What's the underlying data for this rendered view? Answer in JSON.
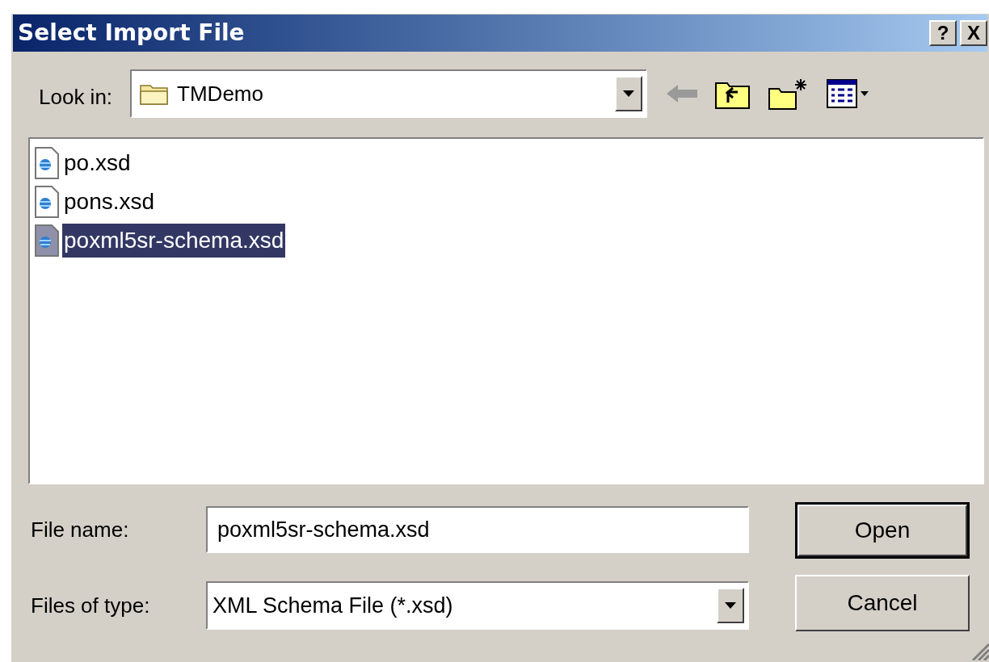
{
  "window": {
    "title": "Select Import File",
    "title_buttons": [
      "?",
      "X"
    ]
  },
  "look_in": {
    "label": "Look in:",
    "value": "TMDemo"
  },
  "files": [
    {
      "name": "po.xsd",
      "selected": false
    },
    {
      "name": "pons.xsd",
      "selected": false
    },
    {
      "name": "poxml5sr-schema.xsd",
      "selected": true
    }
  ],
  "file_name": {
    "label": "File name:",
    "value": "poxml5sr-schema.xsd"
  },
  "file_type": {
    "label": "Files of type:",
    "value": "XML Schema File (*.xsd)"
  },
  "buttons": [
    {
      "label": "Open",
      "default": true
    },
    {
      "label": "Cancel",
      "default": false
    }
  ]
}
